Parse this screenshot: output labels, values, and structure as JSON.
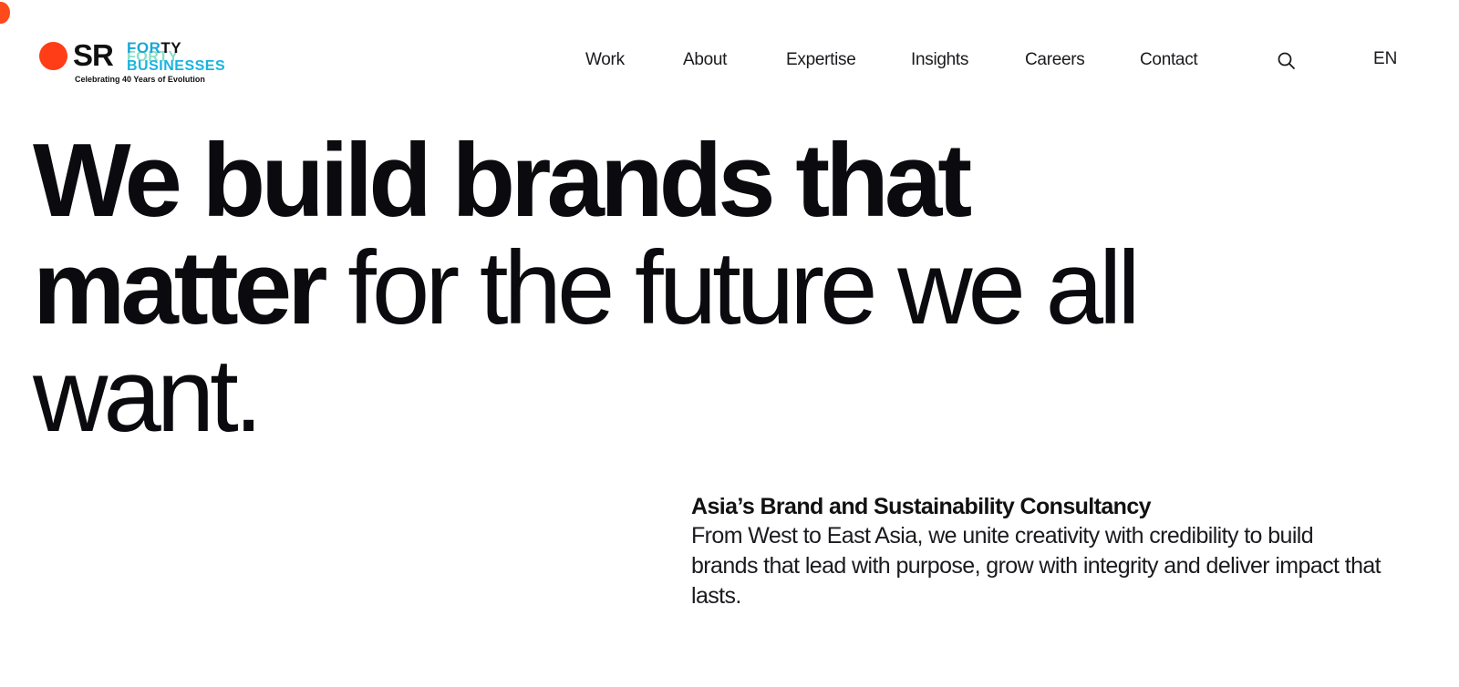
{
  "brand": {
    "logo_mark": "SR",
    "logo_word_top": "FOR",
    "logo_word_top_dark": "TY",
    "logo_word_ghost": "FORTY",
    "logo_word_bottom": "BUSINESSES",
    "tagline": "Celebrating 40 Years of Evolution",
    "accent_color": "#ff3d17",
    "secondary_color": "#1aa6d6"
  },
  "nav": {
    "items": [
      {
        "label": "Work"
      },
      {
        "label": "About"
      },
      {
        "label": "Expertise"
      },
      {
        "label": "Insights"
      },
      {
        "label": "Careers"
      },
      {
        "label": "Contact"
      }
    ],
    "search_icon": "search-icon",
    "language": "EN"
  },
  "hero": {
    "bold_part": "We build brands that matter",
    "light_part": "for the future we all want."
  },
  "intro": {
    "title": "Asia’s Brand and Sustainability Consultancy",
    "body": "From West to East Asia, we unite creativity with credibility to build brands that lead with purpose, grow with integrity and deliver impact that lasts."
  }
}
